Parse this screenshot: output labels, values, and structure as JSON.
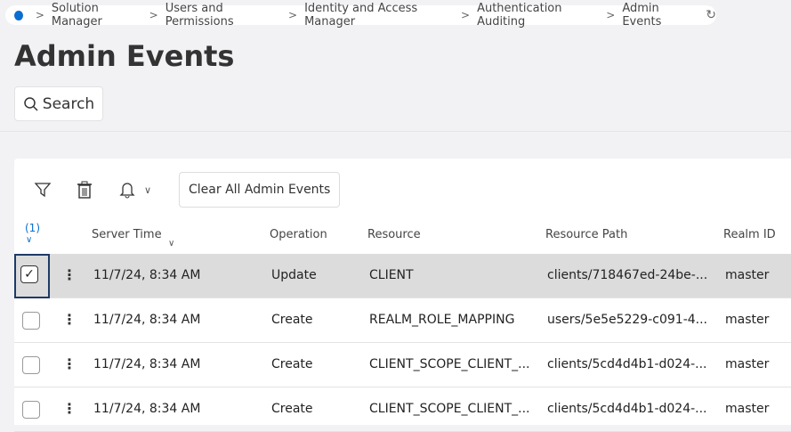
{
  "breadcrumb": [
    "Solution Manager",
    "Users and Permissions",
    "Identity and Access Manager",
    "Authentication Auditing",
    "Admin Events"
  ],
  "title": "Admin Events",
  "search_label": "Search",
  "clear_label": "Clear All Admin Events",
  "selected_count": "(1)",
  "columns": {
    "server_time": "Server Time",
    "operation": "Operation",
    "resource": "Resource",
    "resource_path": "Resource Path",
    "realm_id": "Realm ID"
  },
  "rows": [
    {
      "time": "11/7/24, 8:34 AM",
      "op": "Update",
      "res": "CLIENT",
      "path": "clients/718467ed-24be-...",
      "realm": "master",
      "selected": true
    },
    {
      "time": "11/7/24, 8:34 AM",
      "op": "Create",
      "res": "REALM_ROLE_MAPPING",
      "path": "users/5e5e5229-c091-4...",
      "realm": "master"
    },
    {
      "time": "11/7/24, 8:34 AM",
      "op": "Create",
      "res": "CLIENT_SCOPE_CLIENT_...",
      "path": "clients/5cd4d4b1-d024-...",
      "realm": "master"
    },
    {
      "time": "11/7/24, 8:34 AM",
      "op": "Create",
      "res": "CLIENT_SCOPE_CLIENT_...",
      "path": "clients/5cd4d4b1-d024-...",
      "realm": "master"
    }
  ]
}
